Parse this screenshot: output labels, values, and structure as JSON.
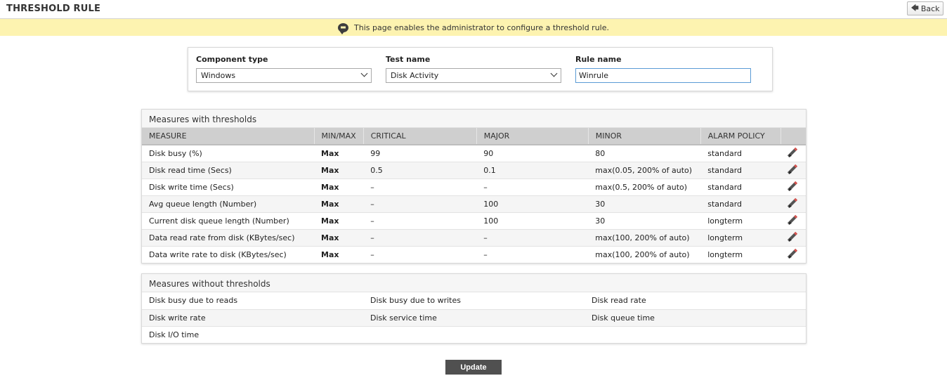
{
  "header": {
    "title": "THRESHOLD RULE",
    "back_label": "Back"
  },
  "notice": {
    "text": "This page enables the administrator to configure a threshold rule."
  },
  "form": {
    "component_type": {
      "label": "Component type",
      "value": "Windows"
    },
    "test_name": {
      "label": "Test name",
      "value": "Disk Activity"
    },
    "rule_name": {
      "label": "Rule name",
      "value": "Winrule"
    }
  },
  "with_thresholds": {
    "title": "Measures with thresholds",
    "columns": [
      "MEASURE",
      "MIN/MAX",
      "CRITICAL",
      "MAJOR",
      "MINOR",
      "ALARM POLICY",
      ""
    ],
    "rows": [
      {
        "measure": "Disk busy (%)",
        "minmax": "Max",
        "critical": "99",
        "major": "90",
        "minor": "80",
        "policy": "standard"
      },
      {
        "measure": "Disk read time (Secs)",
        "minmax": "Max",
        "critical": "0.5",
        "major": "0.1",
        "minor": "max(0.05, 200% of auto)",
        "policy": "standard"
      },
      {
        "measure": "Disk write time (Secs)",
        "minmax": "Max",
        "critical": "–",
        "major": "–",
        "minor": "max(0.5, 200% of auto)",
        "policy": "standard"
      },
      {
        "measure": "Avg queue length (Number)",
        "minmax": "Max",
        "critical": "–",
        "major": "100",
        "minor": "30",
        "policy": "standard"
      },
      {
        "measure": "Current disk queue length (Number)",
        "minmax": "Max",
        "critical": "–",
        "major": "100",
        "minor": "30",
        "policy": "longterm"
      },
      {
        "measure": "Data read rate from disk (KBytes/sec)",
        "minmax": "Max",
        "critical": "–",
        "major": "–",
        "minor": "max(100, 200% of auto)",
        "policy": "longterm"
      },
      {
        "measure": "Data write rate to disk (KBytes/sec)",
        "minmax": "Max",
        "critical": "–",
        "major": "–",
        "minor": "max(100, 200% of auto)",
        "policy": "longterm"
      }
    ]
  },
  "without_thresholds": {
    "title": "Measures without thresholds",
    "rows": [
      [
        "Disk busy due to reads",
        "Disk busy due to writes",
        "Disk read rate"
      ],
      [
        "Disk write rate",
        "Disk service time",
        "Disk queue time"
      ],
      [
        "Disk I/O time",
        "",
        ""
      ]
    ]
  },
  "update_label": "Update",
  "icons": {
    "back": "back-arrow-icon",
    "notice": "chat-bubble-icon",
    "edit": "pencil-icon",
    "dropdown": "chevron-down-icon"
  }
}
